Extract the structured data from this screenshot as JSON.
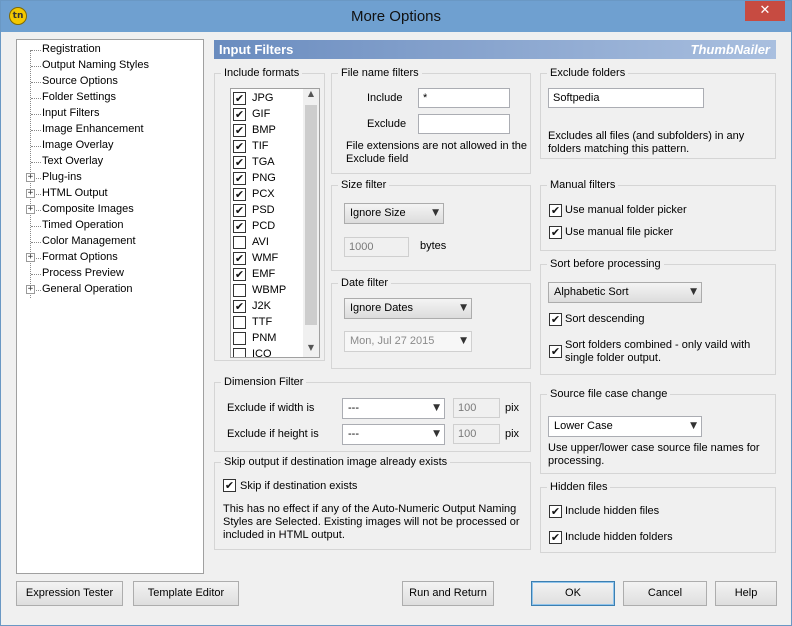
{
  "window": {
    "title": "More Options",
    "app_icon_text": "tn",
    "close_glyph": "✕"
  },
  "tree": {
    "items": [
      {
        "label": "Registration",
        "expandable": false
      },
      {
        "label": "Output Naming Styles",
        "expandable": false
      },
      {
        "label": "Source Options",
        "expandable": false
      },
      {
        "label": "Folder Settings",
        "expandable": false
      },
      {
        "label": "Input Filters",
        "expandable": false
      },
      {
        "label": "Image Enhancement",
        "expandable": false
      },
      {
        "label": "Image Overlay",
        "expandable": false
      },
      {
        "label": "Text Overlay",
        "expandable": false
      },
      {
        "label": "Plug-ins",
        "expandable": true
      },
      {
        "label": "HTML Output",
        "expandable": true
      },
      {
        "label": "Composite Images",
        "expandable": true
      },
      {
        "label": "Timed Operation",
        "expandable": false
      },
      {
        "label": "Color Management",
        "expandable": false
      },
      {
        "label": "Format Options",
        "expandable": true
      },
      {
        "label": "Process Preview",
        "expandable": false
      },
      {
        "label": "General Operation",
        "expandable": true
      }
    ]
  },
  "panel": {
    "title": "Input Filters",
    "brand": "ThumbNailer"
  },
  "include_formats": {
    "title": "Include formats",
    "items": [
      {
        "label": "JPG",
        "checked": true
      },
      {
        "label": "GIF",
        "checked": true
      },
      {
        "label": "BMP",
        "checked": true
      },
      {
        "label": "TIF",
        "checked": true
      },
      {
        "label": "TGA",
        "checked": true
      },
      {
        "label": "PNG",
        "checked": true
      },
      {
        "label": "PCX",
        "checked": true
      },
      {
        "label": "PSD",
        "checked": true
      },
      {
        "label": "PCD",
        "checked": true
      },
      {
        "label": "AVI",
        "checked": false
      },
      {
        "label": "WMF",
        "checked": true
      },
      {
        "label": "EMF",
        "checked": true
      },
      {
        "label": "WBMP",
        "checked": false
      },
      {
        "label": "J2K",
        "checked": true
      },
      {
        "label": "TTF",
        "checked": false
      },
      {
        "label": "PNM",
        "checked": false
      },
      {
        "label": "ICO",
        "checked": false
      }
    ]
  },
  "file_name_filters": {
    "title": "File name filters",
    "include_label": "Include",
    "include_value": "*",
    "exclude_label": "Exclude",
    "exclude_value": "",
    "note": "File extensions are not allowed in the Exclude field"
  },
  "size_filter": {
    "title": "Size filter",
    "mode": "Ignore Size",
    "value": "1000",
    "unit": "bytes"
  },
  "date_filter": {
    "title": "Date filter",
    "mode": "Ignore Dates",
    "date": "Mon,  Jul  27 2015"
  },
  "dimension_filter": {
    "title": "Dimension Filter",
    "width_label": "Exclude if width is",
    "width_op": "---",
    "width_value": "100",
    "height_label": "Exclude if height is",
    "height_op": "---",
    "height_value": "100",
    "unit": "pix"
  },
  "skip_output": {
    "title": "Skip output if destination image already exists",
    "checkbox_label": "Skip if destination exists",
    "checked": true,
    "note": "This has no effect if any of the Auto-Numeric Output Naming Styles are Selected. Existing images will not be processed or included in HTML output."
  },
  "exclude_folders": {
    "title": "Exclude folders",
    "value": "Softpedia",
    "note": "Excludes all files (and subfolders) in any folders matching this pattern."
  },
  "manual_filters": {
    "title": "Manual filters",
    "folder_picker_label": "Use manual folder picker",
    "folder_picker_checked": true,
    "file_picker_label": "Use manual file picker",
    "file_picker_checked": true
  },
  "sort": {
    "title": "Sort before processing",
    "mode": "Alphabetic Sort",
    "descending_label": "Sort descending",
    "descending_checked": true,
    "combined_label": "Sort folders combined - only vaild with single folder output.",
    "combined_checked": true
  },
  "case_change": {
    "title": "Source file case change",
    "mode": "Lower Case",
    "note": "Use upper/lower case source file names for processing."
  },
  "hidden_files": {
    "title": "Hidden files",
    "files_label": "Include hidden files",
    "files_checked": true,
    "folders_label": "Include hidden folders",
    "folders_checked": true
  },
  "buttons": {
    "expression_tester": "Expression Tester",
    "template_editor": "Template Editor",
    "run_and_return": "Run and Return",
    "ok": "OK",
    "cancel": "Cancel",
    "help": "Help"
  },
  "glyphs": {
    "check": "✔",
    "dropdown": "▼",
    "scroll_up": "▲",
    "scroll_down": "▼",
    "expand": "+"
  }
}
